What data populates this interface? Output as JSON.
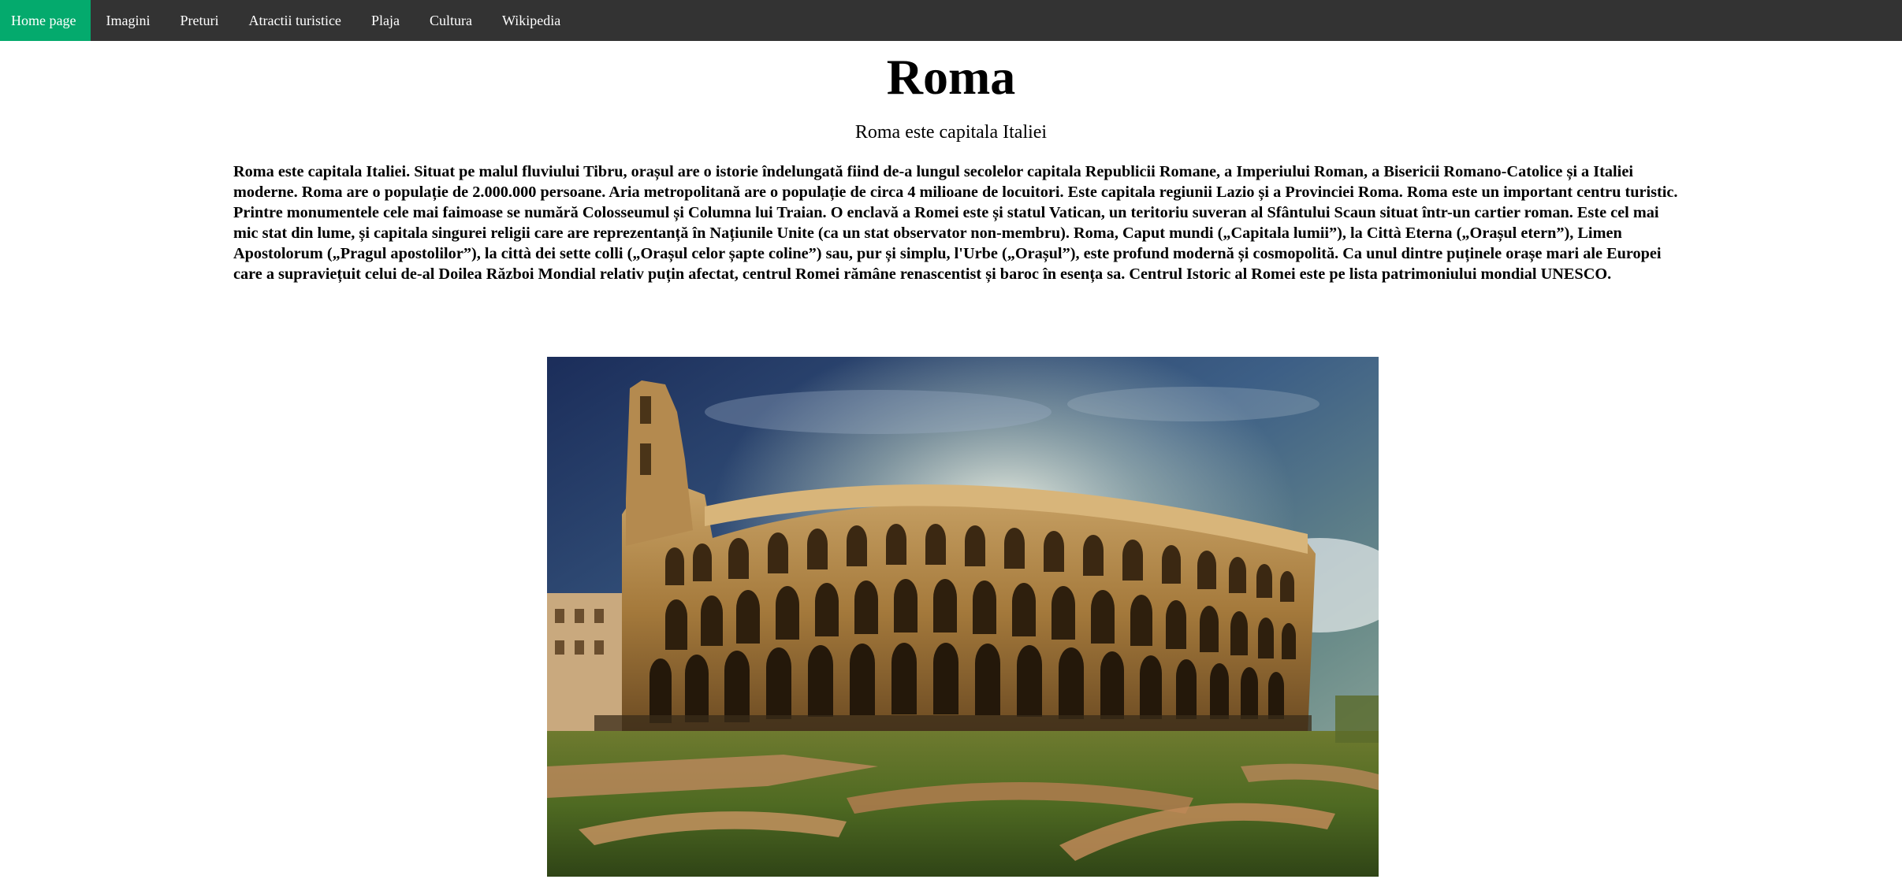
{
  "nav": {
    "items": [
      {
        "label": "Home page",
        "active": true
      },
      {
        "label": "Imagini",
        "active": false
      },
      {
        "label": "Preturi",
        "active": false
      },
      {
        "label": "Atractii turistice",
        "active": false
      },
      {
        "label": "Plaja",
        "active": false
      },
      {
        "label": "Cultura",
        "active": false
      },
      {
        "label": "Wikipedia",
        "active": false
      }
    ],
    "bg_color": "#333333",
    "active_color": "#04AA6D"
  },
  "page": {
    "title": "Roma",
    "subtitle": "Roma este capitala Italiei",
    "paragraph": "Roma este capitala Italiei. Situat pe malul fluviului Tibru, orașul are o istorie îndelungată fiind de-a lungul secolelor capitala Republicii Romane, a Imperiului Roman, a Bisericii Romano-Catolice și a Italiei moderne. Roma are o populație de 2.000.000 persoane. Aria metropolitană are o populație de circa 4 milioane de locuitori. Este capitala regiunii Lazio și a Provinciei Roma. Roma este un important centru turistic. Printre monumentele cele mai faimoase se numără Colosseumul și Columna lui Traian. O enclavă a Romei este și statul Vatican, un teritoriu suveran al Sfântului Scaun situat într-un cartier roman. Este cel mai mic stat din lume, și capitala singurei religii care are reprezentanță în Națiunile Unite (ca un stat observator non-membru). Roma, Caput mundi („Capitala lumii”), la Città Eterna („Orașul etern”), Limen Apostolorum („Pragul apostolilor”), la città dei sette colli („Orașul celor șapte coline”) sau, pur și simplu, l'Urbe („Orașul”), este profund modernă și cosmopolită. Ca unul dintre puținele orașe mari ale Europei care a supraviețuit celui de-al Doilea Război Mondial relativ puțin afectat, centrul Romei rămâne renascentist și baroc în esența sa. Centrul Istoric al Romei este pe lista patrimoniului mondial UNESCO."
  }
}
